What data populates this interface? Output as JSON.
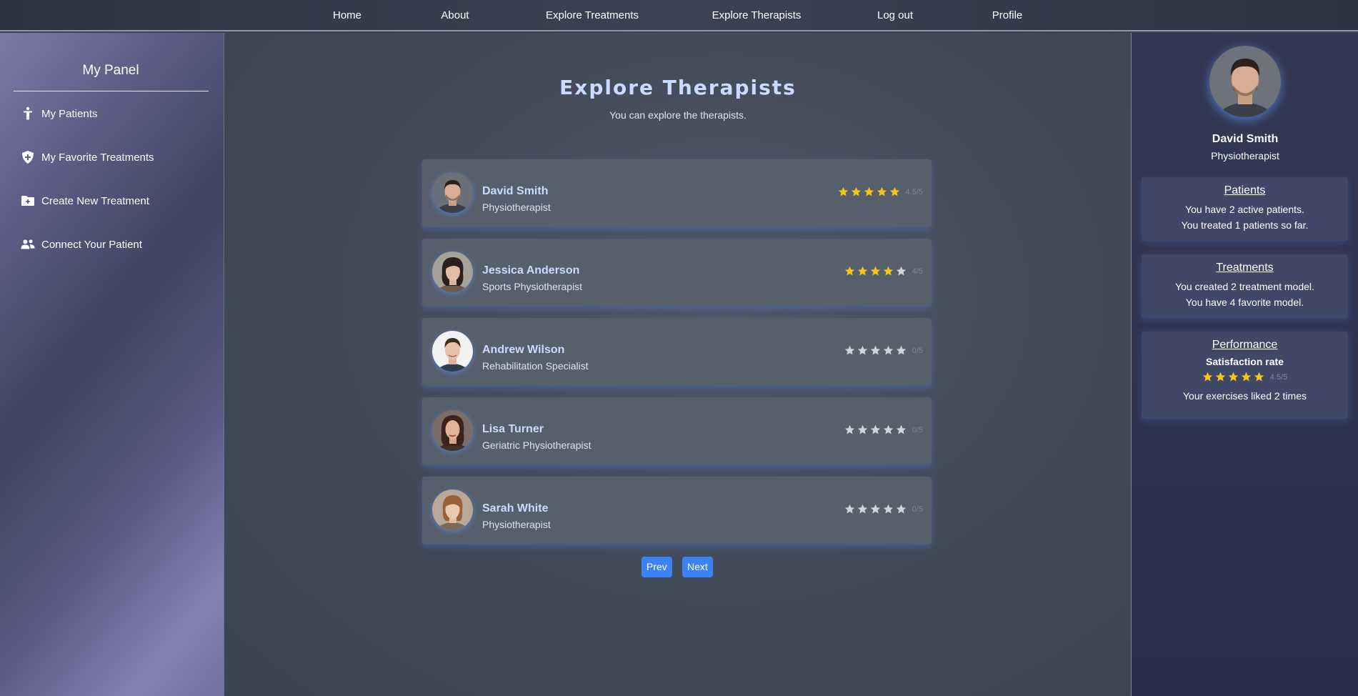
{
  "nav": {
    "items": [
      {
        "label": "Home"
      },
      {
        "label": "About"
      },
      {
        "label": "Explore Treatments"
      },
      {
        "label": "Explore Therapists"
      },
      {
        "label": "Log out"
      },
      {
        "label": "Profile"
      }
    ]
  },
  "sidebar": {
    "title": "My Panel",
    "items": [
      {
        "label": "My Patients",
        "icon": "person-standing-icon"
      },
      {
        "label": "My Favorite Treatments",
        "icon": "shield-plus-icon"
      },
      {
        "label": "Create New Treatment",
        "icon": "folder-plus-icon"
      },
      {
        "label": "Connect Your Patient",
        "icon": "user-group-icon"
      }
    ]
  },
  "main": {
    "title": "Explore Therapists",
    "subtitle": "You can explore the therapists.",
    "therapists": [
      {
        "name": "David Smith",
        "title": "Physiotherapist",
        "rating": 4.5,
        "score": "4.5/5",
        "filled_stars": 5
      },
      {
        "name": "Jessica Anderson",
        "title": "Sports Physiotherapist",
        "rating": 4,
        "score": "4/5",
        "filled_stars": 4
      },
      {
        "name": "Andrew Wilson",
        "title": "Rehabilitation Specialist",
        "rating": 0,
        "score": "0/5",
        "filled_stars": 0
      },
      {
        "name": "Lisa Turner",
        "title": "Geriatric Physiotherapist",
        "rating": 0,
        "score": "0/5",
        "filled_stars": 0
      },
      {
        "name": "Sarah White",
        "title": "Physiotherapist",
        "rating": 0,
        "score": "0/5",
        "filled_stars": 0
      }
    ],
    "pager": {
      "prev": "Prev",
      "next": "Next"
    }
  },
  "profile": {
    "name": "David Smith",
    "role": "Physiotherapist",
    "patients": {
      "title": "Patients",
      "line1": "You have 2 active patients.",
      "line2": "You treated 1 patients so far."
    },
    "treatments": {
      "title": "Treatments",
      "line1": "You created 2 treatment model.",
      "line2": "You have 4 favorite model."
    },
    "performance": {
      "title": "Performance",
      "subtitle": "Satisfaction rate",
      "rating": 4.5,
      "filled_stars": 5,
      "score": "4.5/5",
      "likes": "Your exercises liked 2 times"
    }
  },
  "colors": {
    "accent": "#3b82f6",
    "star_filled": "#f5c518",
    "star_empty": "#d0d4da",
    "name_text": "#c9dcff"
  }
}
